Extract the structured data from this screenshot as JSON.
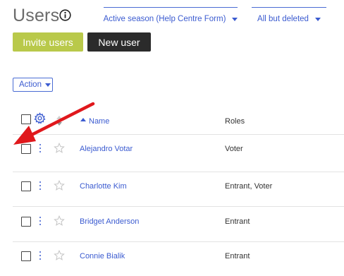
{
  "page": {
    "title": "Users"
  },
  "filters": {
    "season": "Active season (Help Centre Form)",
    "status": "All but deleted"
  },
  "buttons": {
    "invite": "Invite users",
    "new_user": "New user",
    "action": "Action"
  },
  "table": {
    "columns": {
      "name": "Name",
      "roles": "Roles"
    },
    "rows": [
      {
        "name": "Alejandro Votar",
        "roles": "Voter"
      },
      {
        "name": "Charlotte Kim",
        "roles": "Entrant, Voter"
      },
      {
        "name": "Bridget Anderson",
        "roles": "Entrant"
      },
      {
        "name": "Connie Bialik",
        "roles": "Entrant"
      }
    ]
  },
  "colors": {
    "link": "#3b5bd0",
    "invite_button": "#b9c94a",
    "new_user_button": "#2b2b2b",
    "annotation_arrow": "#e0181c"
  },
  "icons": {
    "info": "info-icon",
    "settings": "gear-icon",
    "sort": "sort-icon",
    "row_menu": "kebab-icon",
    "favorite": "star-icon",
    "annotation": "red-arrow"
  }
}
